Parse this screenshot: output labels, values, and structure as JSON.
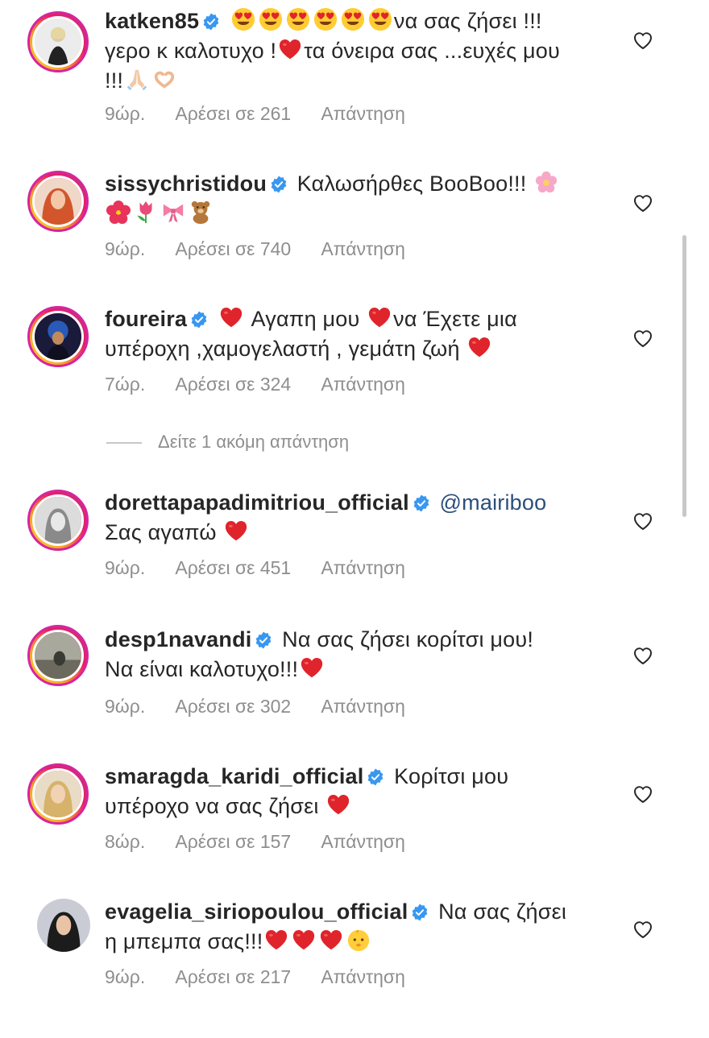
{
  "comments": [
    {
      "username": "katken85",
      "line1": "να σας ζήσει !!!",
      "line2a": "γερο κ καλοτυχο !",
      "line2b": "τα όνειρα σας ...ευχές μου",
      "line3": "!!!",
      "time": "9ώρ.",
      "likes": "Αρέσει σε 261",
      "reply": "Απάντηση"
    },
    {
      "username": "sissychristidou",
      "line1": "Καλωσήρθες BooBoo!!!",
      "time": "9ώρ.",
      "likes": "Αρέσει σε 740",
      "reply": "Απάντηση"
    },
    {
      "username": "foureira",
      "line1a": "Αγαπη μου",
      "line1b": "να Έχετε μια",
      "line2": "υπέροχη ,χαμογελαστή , γεμάτη ζωή",
      "time": "7ώρ.",
      "likes": "Αρέσει σε 324",
      "reply": "Απάντηση"
    },
    {
      "username": "dorettapapadimitriou_official",
      "mention": "@mairiboo",
      "line2": "Σας αγαπώ",
      "time": "9ώρ.",
      "likes": "Αρέσει σε 451",
      "reply": "Απάντηση"
    },
    {
      "username": "desp1navandi",
      "line1": "Να σας ζήσει κορίτσι μου!",
      "line2": "Να είναι καλοτυχο!!!",
      "time": "9ώρ.",
      "likes": "Αρέσει σε 302",
      "reply": "Απάντηση"
    },
    {
      "username": "smaragda_karidi_official",
      "line1": "Κορίτσι μου",
      "line2": "υπέροχο να σας ζήσει",
      "time": "8ώρ.",
      "likes": "Αρέσει σε 157",
      "reply": "Απάντηση"
    },
    {
      "username": "evagelia_siriopoulou_official",
      "line1": "Να σας ζήσει",
      "line2": "η μπεμπα σας!!!",
      "time": "9ώρ.",
      "likes": "Αρέσει σε 217",
      "reply": "Απάντηση"
    }
  ],
  "more_replies": "Δείτε 1 ακόμη απάντηση",
  "icons": {
    "verified": "verified-badge-icon",
    "like": "heart-outline-icon"
  },
  "colors": {
    "verified": "#3897f0",
    "muted": "#8e8e8e",
    "mention": "#2b4f7a",
    "heart_emoji": "#e0242b"
  }
}
